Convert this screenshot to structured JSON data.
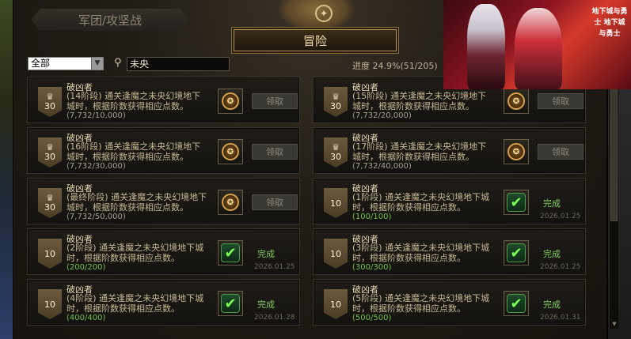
{
  "tabs": {
    "legion_label": "军团/攻坚战",
    "adventure_label": "冒险"
  },
  "filter": {
    "selected": "全部",
    "search_value": "未央",
    "progress_label": "进度 24.9%(51/205)"
  },
  "claim_label": "领取",
  "complete_label": "完成",
  "cards": [
    {
      "title": "破凶者",
      "desc": "(14阶段) 通关逢魔之未央幻境地下城时，根据阶数获得相应点数。",
      "count": "(7,732/10,000)",
      "points": "30",
      "status": "claimable",
      "date": ""
    },
    {
      "title": "破凶者",
      "desc": "(15阶段) 通关逢魔之未央幻境地下城时，根据阶数获得相应点数。",
      "count": "(7,732/20,000)",
      "points": "30",
      "status": "claimable",
      "date": ""
    },
    {
      "title": "破凶者",
      "desc": "(16阶段) 通关逢魔之未央幻境地下城时，根据阶数获得相应点数。",
      "count": "(7,732/30,000)",
      "points": "30",
      "status": "claimable",
      "date": ""
    },
    {
      "title": "破凶者",
      "desc": "(17阶段) 通关逢魔之未央幻境地下城时，根据阶数获得相应点数。",
      "count": "(7,732/40,000)",
      "points": "30",
      "status": "claimable",
      "date": ""
    },
    {
      "title": "破凶者",
      "desc": "(最终阶段) 通关逢魔之未央幻境地下城时，根据阶数获得相应点数。",
      "count": "(7,732/50,000)",
      "points": "30",
      "status": "claimable",
      "date": ""
    },
    {
      "title": "破凶者",
      "desc": "(1阶段) 通关逢魔之未央幻境地下城时，根据阶数获得相应点数。",
      "count": "(100/100)",
      "points": "10",
      "status": "complete",
      "date": "2026.01.25"
    },
    {
      "title": "破凶者",
      "desc": "(2阶段) 通关逢魔之未央幻境地下城时，根据阶数获得相应点数。",
      "count": "(200/200)",
      "points": "10",
      "status": "complete",
      "date": "2026.01.25"
    },
    {
      "title": "破凶者",
      "desc": "(3阶段) 通关逢魔之未央幻境地下城时，根据阶数获得相应点数。",
      "count": "(300/300)",
      "points": "10",
      "status": "complete",
      "date": "2026.01.25"
    },
    {
      "title": "破凶者",
      "desc": "(4阶段) 通关逢魔之未央幻境地下城时，根据阶数获得相应点数。",
      "count": "(400/400)",
      "points": "10",
      "status": "complete",
      "date": "2026.01.28"
    },
    {
      "title": "破凶者",
      "desc": "(5阶段) 通关逢魔之未央幻境地下城时，根据阶数获得相应点数。",
      "count": "(500/500)",
      "points": "10",
      "status": "complete",
      "date": "2026.01.31"
    }
  ],
  "promo": {
    "logo_text": "地下城与勇士 地下城与勇士"
  },
  "icons": {
    "trophy": "trophy-icon",
    "medal": "medal-icon",
    "check": "check-icon",
    "search": "search-icon",
    "compass": "compass-icon"
  }
}
